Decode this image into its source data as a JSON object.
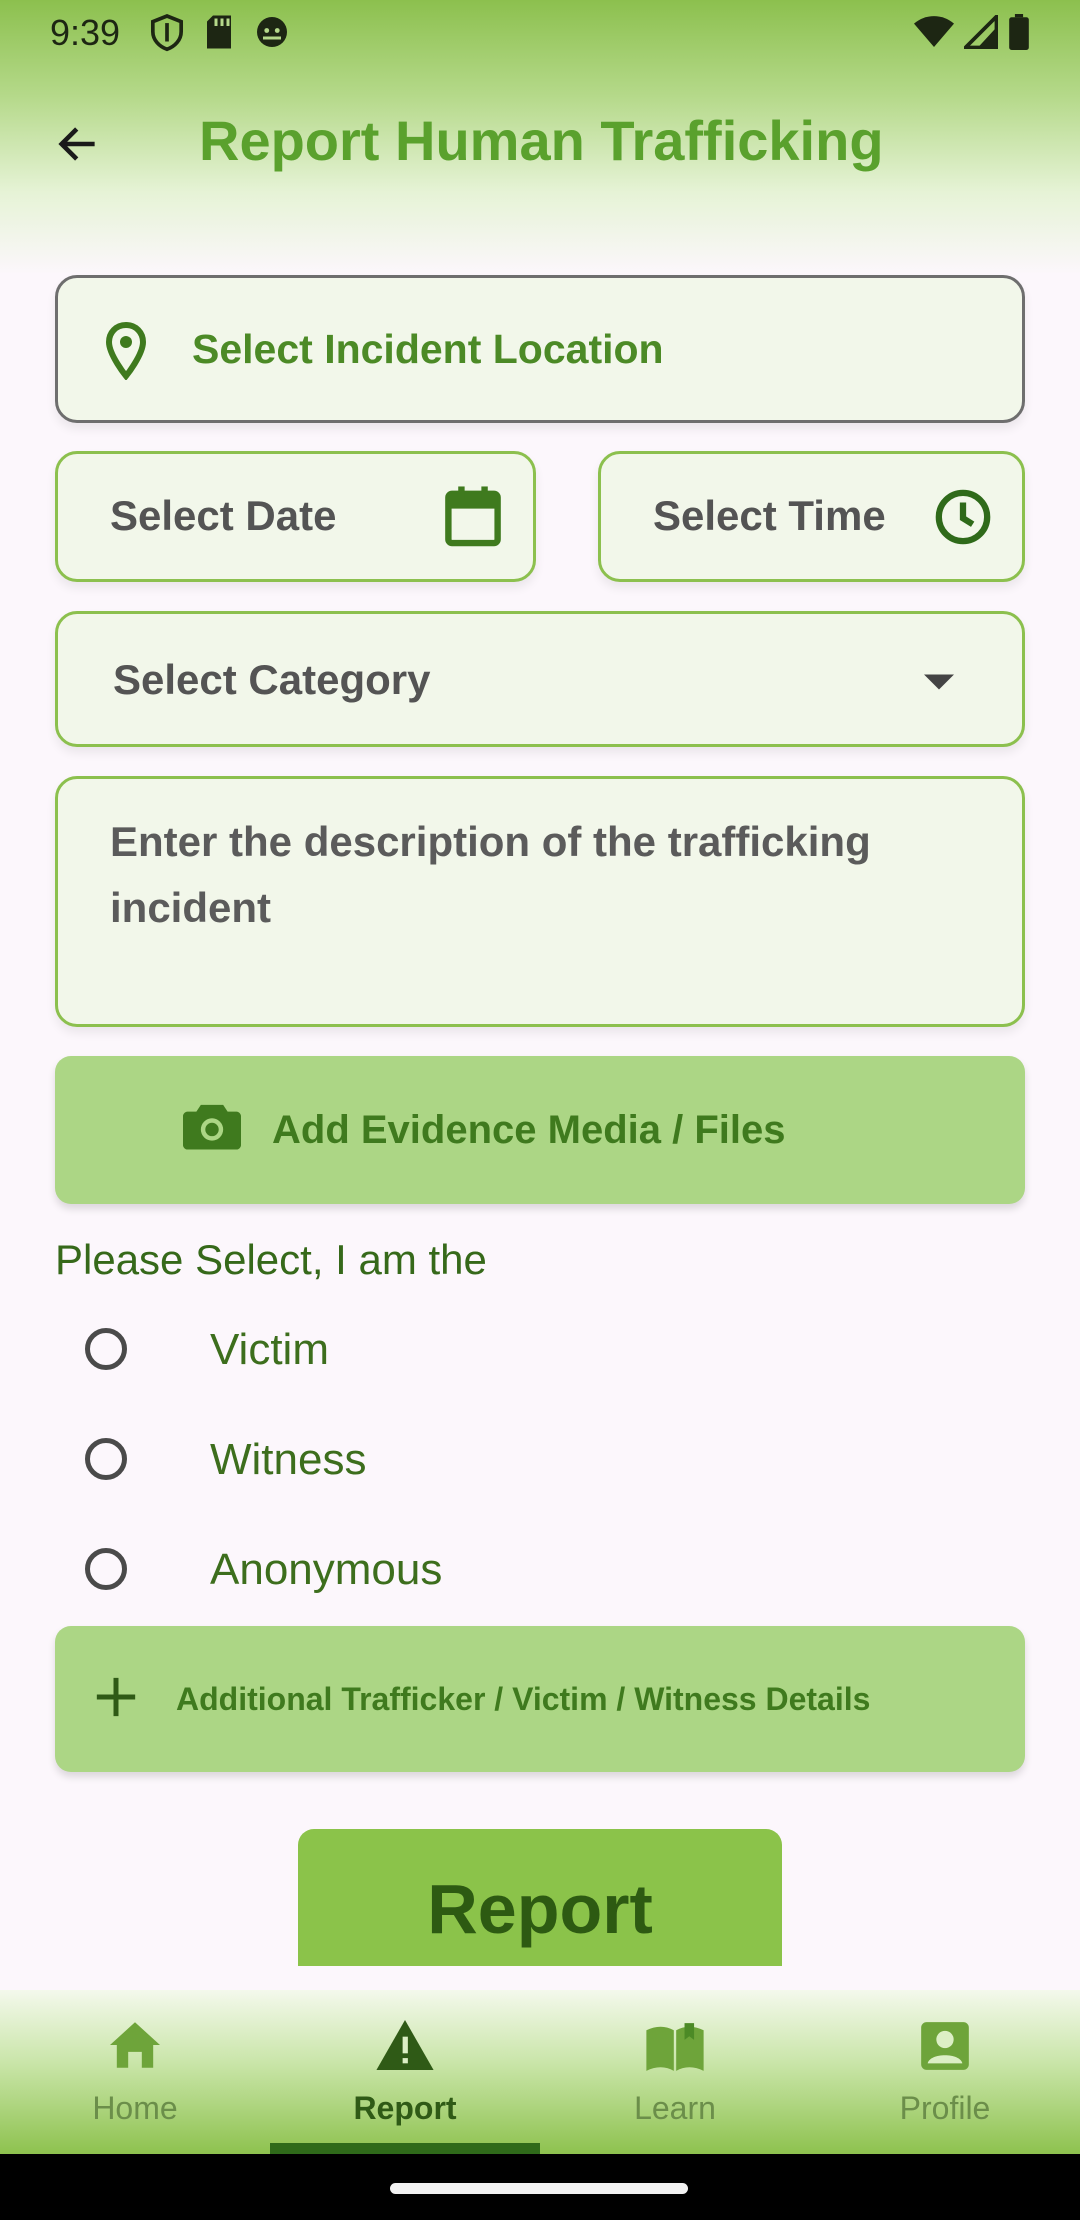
{
  "status_bar": {
    "time": "9:39"
  },
  "header": {
    "title": "Report Human Trafficking",
    "back_icon": "arrow-left-icon"
  },
  "form": {
    "location": {
      "label": "Select Incident Location",
      "icon": "location-pin-icon"
    },
    "date": {
      "label": "Select Date",
      "icon": "calendar-icon"
    },
    "time": {
      "label": "Select Time",
      "icon": "clock-icon"
    },
    "category": {
      "label": "Select Category",
      "icon": "dropdown-arrow-icon"
    },
    "description": {
      "placeholder": "Enter the description of the trafficking incident"
    },
    "evidence": {
      "label": "Add Evidence Media / Files",
      "icon": "camera-icon"
    },
    "role": {
      "title": "Please Select, I am the",
      "options": [
        "Victim",
        "Witness",
        "Anonymous"
      ]
    },
    "additional": {
      "label": "Additional Trafficker / Victim / Witness Details",
      "icon": "plus-icon"
    },
    "submit": {
      "label": "Report"
    }
  },
  "bottom_nav": {
    "items": [
      {
        "label": "Home",
        "icon": "home-icon",
        "active": false
      },
      {
        "label": "Report",
        "icon": "warning-icon",
        "active": true
      },
      {
        "label": "Learn",
        "icon": "book-icon",
        "active": false
      },
      {
        "label": "Profile",
        "icon": "profile-icon",
        "active": false
      }
    ]
  },
  "colors": {
    "accent": "#8bc34a",
    "title_green": "#5aa12d",
    "button_green": "#acd685",
    "field_bg": "#f2f7ea"
  }
}
